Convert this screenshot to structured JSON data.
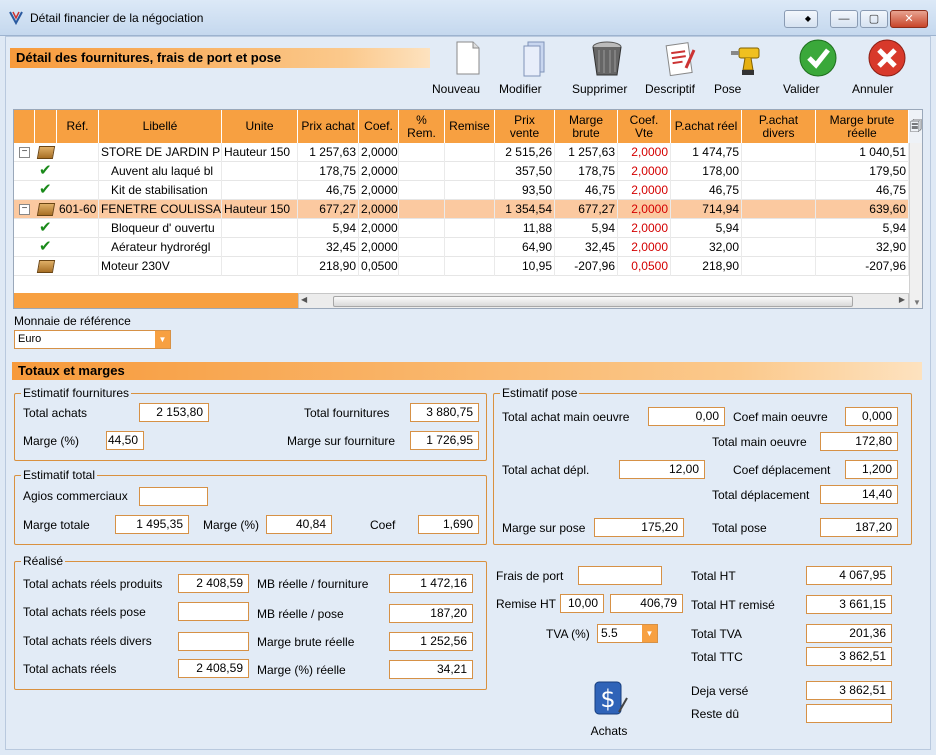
{
  "window": {
    "title": "Détail financier de la négociation",
    "btn_min": "—",
    "btn_max": "▢",
    "btn_close": "✕"
  },
  "header": {
    "title": "Détail des fournitures, frais de port et pose"
  },
  "toolbar": [
    {
      "id": "nouveau",
      "label": "Nouveau",
      "icon": "new-document-icon"
    },
    {
      "id": "modifier",
      "label": "Modifier",
      "icon": "edit-documents-icon"
    },
    {
      "id": "supprimer",
      "label": "Supprimer",
      "icon": "trash-bin-icon"
    },
    {
      "id": "descriptif",
      "label": "Descriptif",
      "icon": "descriptif-icon"
    },
    {
      "id": "pose",
      "label": "Pose",
      "icon": "drill-icon"
    },
    {
      "id": "valider",
      "label": "Valider",
      "icon": "check-circle-icon"
    },
    {
      "id": "annuler",
      "label": "Annuler",
      "icon": "cancel-circle-icon"
    }
  ],
  "grid": {
    "columns": [
      "Réf.",
      "Libellé",
      "Unite",
      "Prix achat",
      "Coef.",
      "% Rem.",
      "Remise",
      "Prix vente",
      "Marge brute",
      "Coef. Vte",
      "P.achat réel",
      "P.achat divers",
      "Marge brute réelle"
    ],
    "rows": [
      {
        "kind": "group",
        "expander": "−",
        "ref": "",
        "libelle": "STORE DE JARDIN PL",
        "unite": "Hauteur 150",
        "prix_achat": "1 257,63",
        "coef": "2,0000",
        "rem": "",
        "remise": "",
        "prix_vente": "2 515,26",
        "marge": "1 257,63",
        "coef_vte": "2,0000",
        "pachat_reel": "1 474,75",
        "pachat_divers": "",
        "marge_reelle": "1 040,51"
      },
      {
        "kind": "child",
        "ref": "",
        "libelle": "Auvent alu laqué bl",
        "unite": "",
        "prix_achat": "178,75",
        "coef": "2,0000",
        "rem": "",
        "remise": "",
        "prix_vente": "357,50",
        "marge": "178,75",
        "coef_vte": "2,0000",
        "pachat_reel": "178,00",
        "pachat_divers": "",
        "marge_reelle": "179,50"
      },
      {
        "kind": "child",
        "ref": "",
        "libelle": "Kit de stabilisation",
        "unite": "",
        "prix_achat": "46,75",
        "coef": "2,0000",
        "rem": "",
        "remise": "",
        "prix_vente": "93,50",
        "marge": "46,75",
        "coef_vte": "2,0000",
        "pachat_reel": "46,75",
        "pachat_divers": "",
        "marge_reelle": "46,75"
      },
      {
        "kind": "group",
        "selected": true,
        "expander": "−",
        "ref": "601-60",
        "libelle": "FENETRE COULISSAN",
        "unite": "Hauteur 150",
        "prix_achat": "677,27",
        "coef": "2,0000",
        "rem": "",
        "remise": "",
        "prix_vente": "1 354,54",
        "marge": "677,27",
        "coef_vte": "2,0000",
        "pachat_reel": "714,94",
        "pachat_divers": "",
        "marge_reelle": "639,60"
      },
      {
        "kind": "child",
        "ref": "",
        "libelle": "Bloqueur d' ouvertu",
        "unite": "",
        "prix_achat": "5,94",
        "coef": "2,0000",
        "rem": "",
        "remise": "",
        "prix_vente": "11,88",
        "marge": "5,94",
        "coef_vte": "2,0000",
        "pachat_reel": "5,94",
        "pachat_divers": "",
        "marge_reelle": "5,94"
      },
      {
        "kind": "child",
        "ref": "",
        "libelle": "Aérateur hydrorégl",
        "unite": "",
        "prix_achat": "32,45",
        "coef": "2,0000",
        "rem": "",
        "remise": "",
        "prix_vente": "64,90",
        "marge": "32,45",
        "coef_vte": "2,0000",
        "pachat_reel": "32,00",
        "pachat_divers": "",
        "marge_reelle": "32,90"
      },
      {
        "kind": "item",
        "ref": "",
        "libelle": "Moteur 230V",
        "unite": "",
        "prix_achat": "218,90",
        "coef": "0,0500",
        "rem": "",
        "remise": "",
        "prix_vente": "10,95",
        "marge": "-207,96",
        "coef_vte": "0,0500",
        "pachat_reel": "218,90",
        "pachat_divers": "",
        "marge_reelle": "-207,96"
      }
    ]
  },
  "currency": {
    "label": "Monnaie de référence",
    "value": "Euro"
  },
  "totals_header": "Totaux et marges",
  "est_fournitures": {
    "title": "Estimatif fournitures",
    "total_achats_label": "Total achats",
    "total_achats": "2 153,80",
    "marge_label": "Marge (%)",
    "marge": "44,50",
    "total_fournitures_label": "Total fournitures",
    "total_fournitures": "3 880,75",
    "marge_fourniture_label": "Marge sur fourniture",
    "marge_fourniture": "1 726,95"
  },
  "est_total": {
    "title": "Estimatif total",
    "agios_label": "Agios commerciaux",
    "agios": "",
    "marge_totale_label": "Marge totale",
    "marge_totale": "1 495,35",
    "marge_pct_label": "Marge (%)",
    "marge_pct": "40,84",
    "coef_label": "Coef",
    "coef": "1,690"
  },
  "realise": {
    "title": "Réalisé",
    "produits_label": "Total achats réels produits",
    "produits": "2 408,59",
    "pose_label": "Total achats réels pose",
    "pose": "",
    "divers_label": "Total achats réels divers",
    "divers": "",
    "reels_label": "Total achats réels",
    "reels": "2 408,59",
    "mb_fourniture_label": "MB réelle / fourniture",
    "mb_fourniture": "1 472,16",
    "mb_pose_label": "MB réelle / pose",
    "mb_pose": "187,20",
    "marge_brute_label": "Marge brute réelle",
    "marge_brute": "1 252,56",
    "marge_pct_label": "Marge (%) réelle",
    "marge_pct": "34,21"
  },
  "est_pose": {
    "title": "Estimatif pose",
    "achat_mo_label": "Total achat main oeuvre",
    "achat_mo": "0,00",
    "coef_mo_label": "Coef main oeuvre",
    "coef_mo": "0,000",
    "total_mo_label": "Total main oeuvre",
    "total_mo": "172,80",
    "achat_depl_label": "Total achat dépl.",
    "achat_depl": "12,00",
    "coef_depl_label": "Coef déplacement",
    "coef_depl": "1,200",
    "total_depl_label": "Total déplacement",
    "total_depl": "14,40",
    "marge_pose_label": "Marge sur pose",
    "marge_pose": "175,20",
    "total_pose_label": "Total pose",
    "total_pose": "187,20"
  },
  "bottom": {
    "frais_port_label": "Frais de port",
    "frais_port": "",
    "remise_ht_label": "Remise HT",
    "remise_ht_pct": "10,00",
    "remise_ht": "406,79",
    "tva_label": "TVA (%)",
    "tva": "5.5",
    "total_ht_label": "Total HT",
    "total_ht": "4 067,95",
    "total_ht_remise_label": "Total HT remisé",
    "total_ht_remise": "3 661,15",
    "total_tva_label": "Total TVA",
    "total_tva": "201,36",
    "total_ttc_label": "Total TTC",
    "total_ttc": "3 862,51",
    "deja_verse_label": "Deja versé",
    "deja_verse": "3 862,51",
    "reste_du_label": "Reste dû",
    "reste_du": "",
    "achats_label": "Achats"
  }
}
